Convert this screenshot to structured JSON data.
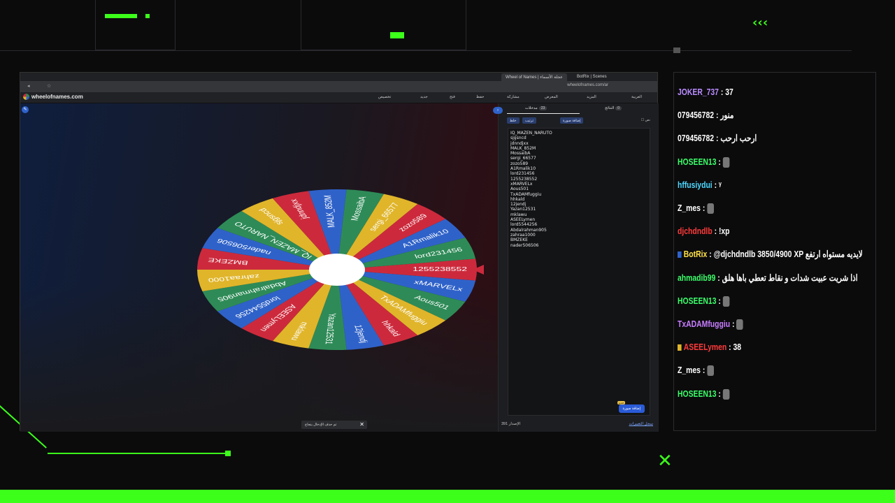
{
  "colors": {
    "accent_green": "#3cff1a",
    "wheel_green": "#2e8b57",
    "wheel_blue": "#2f62c9",
    "wheel_yellow": "#e0b52a",
    "wheel_red": "#cc2a3c"
  },
  "decor": {
    "chevrons_top": "‹‹‹",
    "chevrons_toast": "»"
  },
  "browser": {
    "tabs": [
      "Wheel of Names | عجلة الأسماء",
      "BotRix | Scenes"
    ],
    "url": "wheelofnames.com/ar",
    "site_name": "wheelofnames.com",
    "menu": [
      "تخصيص",
      "جديد",
      "فتح",
      "حفظ",
      "مشاركة",
      "المعرض",
      "المزيد",
      "العربية"
    ]
  },
  "wheel": {
    "segments": [
      "1255238552",
      "xMARVELx",
      "Aous501",
      "TxADAMfuggiu",
      "hhkald",
      "12jendj",
      "Yazan12531",
      "mklawu",
      "ASEELymen",
      "lord5544256",
      "Abdalrahman905",
      "zahraa1000",
      "BMZEKE",
      "nader506506",
      "IQ_MAZEN_NARUTO",
      "sjgsncd",
      "jdnndjxx",
      "MALK_852M",
      "MossaibA",
      "sergi_66577",
      "zozo589",
      "A1Rmalik10",
      "lord231456"
    ]
  },
  "panel": {
    "tab_entries": "مدخلات",
    "tab_entries_count": "23",
    "tab_results": "النتائج",
    "tab_results_count": "0",
    "btn_shuffle": "خلط",
    "btn_sort": "ترتيب",
    "btn_add_image": "إضافة صورة",
    "checkbox_label": "نص",
    "entries": [
      "IQ_MAZEN_NARUTO",
      "sjgsncd",
      "jdnndjxx",
      "MALK_852M",
      "MossaibA",
      "sergi_66577",
      "zozo589",
      "A1Rmalik10",
      "lord231456",
      "1255238552",
      "xMARVELx",
      "Aous501",
      "TxADAMfuggiu",
      "hhkald",
      "12jendj",
      "Yazan12531",
      "mklawu",
      "ASEELymen",
      "lord5544256",
      "Abdalrahman905",
      "zahraa1000",
      "BMZEKE",
      "nader506506"
    ],
    "add_image_button": "إضافة صورة",
    "new_badge": "جديد",
    "version_label": "الإصدار",
    "version_value": "391",
    "changelog_link": "سجل التغييرات"
  },
  "toast": {
    "text": "تم حذف الإدخال بنجاح",
    "close": "✕"
  },
  "chat": {
    "messages": [
      {
        "user": "JOKER_737",
        "text": "37",
        "color": "#b98cff"
      },
      {
        "user": "079456782",
        "text": "منور",
        "color": "#ffffff"
      },
      {
        "user": "079456782",
        "text": "ارحب ارحب",
        "color": "#ffffff"
      },
      {
        "user": "HOSEEN13",
        "text": "",
        "color": "#3cff6a",
        "emote": true
      },
      {
        "user": "hffusiydui",
        "text": "ᵞ",
        "color": "#4fd9ff"
      },
      {
        "user": "Z_mes",
        "text": "",
        "color": "#ffffff",
        "emote": true
      },
      {
        "user": "djchdndlb",
        "text": "!xp",
        "color": "#ff3a3a"
      },
      {
        "user": "BotRix",
        "text": "@djchdndlb 3850/4900 XP لايديه مستواه ارتفع",
        "color": "#ffe24a",
        "bot": true
      },
      {
        "user": "ahmadib99",
        "text": "اذا شريت عبيت شدات و نقاط تعطي باها هلق",
        "color": "#3cff6a"
      },
      {
        "user": "HOSEEN13",
        "text": "",
        "color": "#3cff6a",
        "emote": true
      },
      {
        "user": "TxADAMfuggiu",
        "text": "",
        "color": "#c77dff",
        "emote": true
      },
      {
        "user": "ASEELymen",
        "text": "38",
        "color": "#ff3a3a",
        "gold": true
      },
      {
        "user": "Z_mes",
        "text": "",
        "color": "#ffffff",
        "emote": true
      },
      {
        "user": "HOSEEN13",
        "text": "",
        "color": "#3cff6a",
        "emote": true
      }
    ]
  }
}
